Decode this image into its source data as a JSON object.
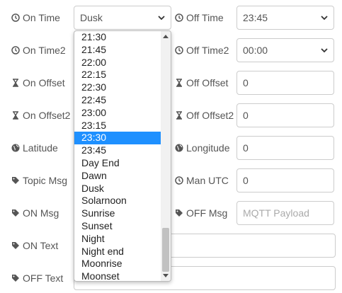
{
  "rows": {
    "on_time": {
      "label": "On Time",
      "value": "Dusk",
      "icon": "clock-icon"
    },
    "off_time": {
      "label": "Off Time",
      "value": "23:45",
      "icon": "clock-icon"
    },
    "on_time2": {
      "label": "On Time2",
      "icon": "clock-icon"
    },
    "off_time2": {
      "label": "Off Time2",
      "value": "00:00",
      "icon": "clock-icon"
    },
    "on_offset": {
      "label": "On Offset",
      "icon": "hourglass-icon"
    },
    "off_offset": {
      "label": "Off Offset",
      "value": "0",
      "icon": "hourglass-icon"
    },
    "on_offset2": {
      "label": "On Offset2",
      "icon": "hourglass-icon"
    },
    "off_offset2": {
      "label": "Off Offset2",
      "value": "0",
      "icon": "hourglass-icon"
    },
    "latitude": {
      "label": "Latitude",
      "icon": "globe-icon"
    },
    "longitude": {
      "label": "Longitude",
      "value": "0",
      "icon": "globe-icon"
    },
    "topic_msg": {
      "label": "Topic Msg",
      "icon": "tag-icon"
    },
    "man_utc": {
      "label": "Man UTC",
      "value": "0",
      "icon": "clock-icon"
    },
    "on_msg": {
      "label": "ON Msg",
      "icon": "tag-icon"
    },
    "off_msg": {
      "label": "OFF Msg",
      "placeholder": "MQTT Payload",
      "icon": "tag-icon"
    },
    "on_text": {
      "label": "ON Text",
      "icon": "tag-icon"
    },
    "off_text": {
      "label": "OFF Text",
      "icon": "tag-icon"
    }
  },
  "dropdown": {
    "options": [
      "21:30",
      "21:45",
      "22:00",
      "22:15",
      "22:30",
      "22:45",
      "23:00",
      "23:15",
      "23:30",
      "23:45",
      "Day End",
      "Dawn",
      "Dusk",
      "Solarnoon",
      "Sunrise",
      "Sunset",
      "Night",
      "Night end",
      "Moonrise",
      "Moonset"
    ],
    "highlighted": "23:30"
  },
  "colors": {
    "highlight": "#1e90ff",
    "border": "#cccccc",
    "label": "#555555"
  }
}
